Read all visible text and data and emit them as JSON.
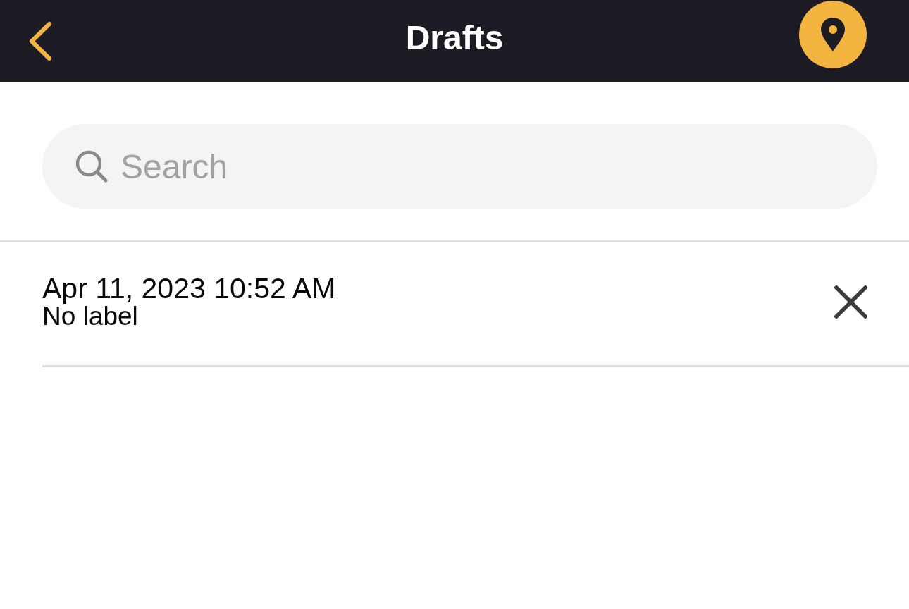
{
  "header": {
    "title": "Drafts"
  },
  "search": {
    "placeholder": "Search"
  },
  "drafts": [
    {
      "title": "Apr 11, 2023 10:52 AM",
      "label": "No label"
    }
  ]
}
